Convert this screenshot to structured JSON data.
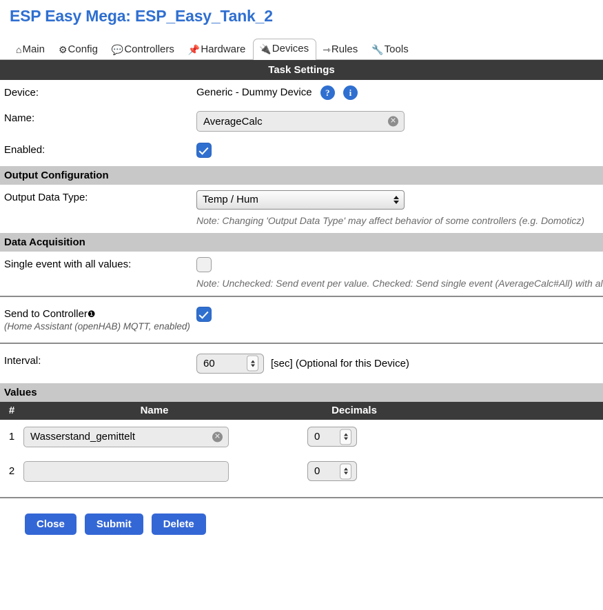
{
  "page_title": "ESP Easy Mega: ESP_Easy_Tank_2",
  "accent_color": "#2f6fd0",
  "tabs": [
    {
      "label": "Main",
      "icon": "home-icon",
      "glyph": "⌂",
      "active": false
    },
    {
      "label": "Config",
      "icon": "gear-icon",
      "glyph": "⚙",
      "active": false
    },
    {
      "label": "Controllers",
      "icon": "speech-balloon-icon",
      "glyph": "💬",
      "active": false
    },
    {
      "label": "Hardware",
      "icon": "pushpin-icon",
      "glyph": "📌",
      "active": false
    },
    {
      "label": "Devices",
      "icon": "electric-plug-icon",
      "glyph": "🔌",
      "active": true
    },
    {
      "label": "Rules",
      "icon": "arrow-icon",
      "glyph": "⇾",
      "active": false
    },
    {
      "label": "Tools",
      "icon": "wrench-icon",
      "glyph": "🔧",
      "active": false
    }
  ],
  "task_settings": {
    "header": "Task Settings",
    "device_label": "Device:",
    "device_value": "Generic - Dummy Device",
    "help_badge": "?",
    "info_badge": "i",
    "name_label": "Name:",
    "name_value": "AverageCalc",
    "clear_glyph": "✕",
    "enabled_label": "Enabled:",
    "enabled_checked": true
  },
  "output_configuration": {
    "header": "Output Configuration",
    "data_type_label": "Output Data Type:",
    "data_type_value": "Temp / Hum",
    "note": "Note: Changing 'Output Data Type' may affect behavior of some controllers (e.g. Domoticz)"
  },
  "data_acquisition": {
    "header": "Data Acquisition",
    "single_event_label": "Single event with all values:",
    "single_event_checked": false,
    "note": "Note: Unchecked: Send event per value. Checked: Send single event (AverageCalc#All) with all values"
  },
  "controller": {
    "label": "Send to Controller",
    "number_glyph": "❶",
    "sub_label": "(Home Assistant (openHAB) MQTT, enabled)",
    "checked": true
  },
  "interval": {
    "label": "Interval:",
    "value": "60",
    "suffix": "[sec] (Optional for this Device)"
  },
  "values": {
    "header": "Values",
    "columns": {
      "num": "#",
      "name": "Name",
      "decimals": "Decimals"
    },
    "rows": [
      {
        "num": "1",
        "name": "Wasserstand_gemittelt",
        "decimals": "0"
      },
      {
        "num": "2",
        "name": "",
        "decimals": "0"
      }
    ]
  },
  "buttons": {
    "close": "Close",
    "submit": "Submit",
    "delete": "Delete"
  }
}
